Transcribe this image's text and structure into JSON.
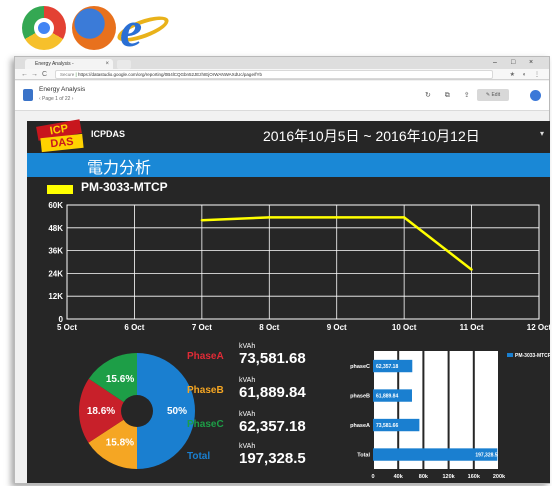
{
  "browser": {
    "tab_title": "Energy Analysis -",
    "tab_close": "×",
    "url_secure": "Secure",
    "url_text": "https://datastudio.google.com/org/reporting/0B4lCQGbn52JEzhIEjOrWANWAXdUc/page/fYb",
    "controls": [
      "–",
      "□",
      "×"
    ],
    "nav": [
      "←",
      "→",
      "C"
    ],
    "ext_icons": "★ ◐ ⋮"
  },
  "app": {
    "title": "Energy Analysis",
    "page": "‹  Page 1 of 22  ›",
    "toolbar_icons": "↻ ⧉ ⇪",
    "edit_label": "✎ Edit"
  },
  "dashboard": {
    "company": "ICPDAS",
    "logo_top": "ICP",
    "logo_bottom": "DAS",
    "date_range": "2016年10月5日 ~ 2016年10月12日",
    "menu_icon": "▾",
    "section_title": "電力分析",
    "colors": {
      "accent": "#1a88d6",
      "background": "#262626",
      "line": "#ffff00"
    }
  },
  "chart_data": [
    {
      "type": "line",
      "legend": "PM-3033-MTCP",
      "x": [
        "7 Oct",
        "8 Oct",
        "9 Oct",
        "10 Oct",
        "11 Oct"
      ],
      "xticks": [
        "5 Oct",
        "6 Oct",
        "7 Oct",
        "8 Oct",
        "9 Oct",
        "10 Oct",
        "11 Oct",
        "12 Oct"
      ],
      "series": [
        {
          "name": "PM-3033-MTCP",
          "values": [
            52000,
            53500,
            53500,
            53500,
            26000
          ],
          "color": "#ffff00"
        }
      ],
      "yticks": [
        "0",
        "12K",
        "24K",
        "36K",
        "48K",
        "60K"
      ],
      "ylim": [
        0,
        60000
      ],
      "grid": true
    },
    {
      "type": "pie",
      "labels": [
        "PhaseA",
        "PhaseB",
        "PhaseC"
      ],
      "values": [
        50,
        15.8,
        18.6,
        15.6
      ],
      "slice_labels": [
        "50%",
        "15.8%",
        "18.6%",
        "15.6%"
      ],
      "colors": [
        "#1a7fd0",
        "#f5a623",
        "#c8202a",
        "#1d9e47"
      ]
    },
    {
      "type": "bar",
      "orientation": "horizontal",
      "legend": "PM-3033-MTCP",
      "categories": [
        "phaseC",
        "phaseB",
        "phaseA",
        "Total"
      ],
      "values": [
        62357.18,
        61889.84,
        73581.66,
        197328.5
      ],
      "data_labels": [
        "62,357.18",
        "61,889.84",
        "73,581.66",
        "197,328.5"
      ],
      "xticks": [
        "0",
        "40k",
        "80k",
        "120k",
        "160k",
        "200k"
      ],
      "xlim": [
        0,
        200000
      ],
      "color": "#1a7fd0"
    }
  ],
  "summary": [
    {
      "phase": "PhaseA",
      "unit": "kVAh",
      "value": "73,581.68",
      "color": "#e02b36"
    },
    {
      "phase": "PhaseB",
      "unit": "kVAh",
      "value": "61,889.84",
      "color": "#f5a623"
    },
    {
      "phase": "PhaseC",
      "unit": "kVAh",
      "value": "62,357.18",
      "color": "#1d9e47"
    },
    {
      "phase": "Total",
      "unit": "kVAh",
      "value": "197,328.5",
      "color": "#1a7fd0"
    }
  ]
}
